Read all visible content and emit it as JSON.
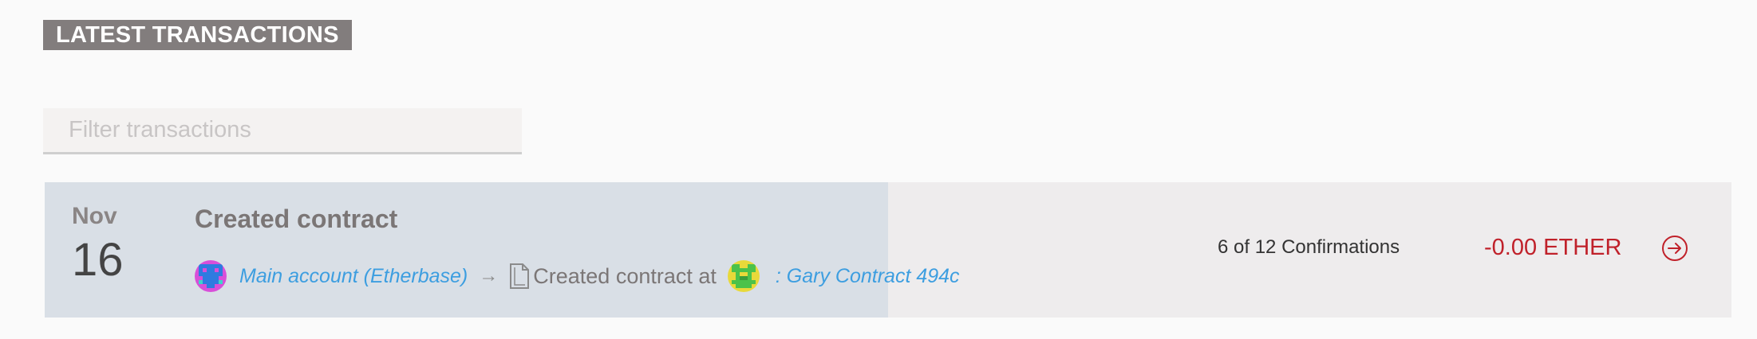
{
  "section": {
    "heading": "LATEST TRANSACTIONS"
  },
  "filter": {
    "placeholder": "Filter transactions",
    "value": ""
  },
  "transactions": [
    {
      "month": "Nov",
      "day": "16",
      "title": "Created contract",
      "from": {
        "name": "Main account (Etherbase)",
        "identicon": "identicon-magenta-blue"
      },
      "arrow_icon": "arrow-right-icon",
      "doc_icon": "document-icon",
      "action_text": "Created contract at",
      "to": {
        "name": ": Gary Contract 494c",
        "identicon": "identicon-yellow-green"
      },
      "confirmations": "6 of 12 Confirmations",
      "confirmation_progress": 0.5,
      "amount": "-0.00 ETHER",
      "details_icon": "circle-arrow-right-icon"
    }
  ],
  "colors": {
    "heading_bg": "#827d7d",
    "row_bg": "#eeeced",
    "progress_bg": "#d9dfe6",
    "link": "#3d9ee0",
    "amount_negative": "#c0212a",
    "details_icon": "#c0212a"
  }
}
